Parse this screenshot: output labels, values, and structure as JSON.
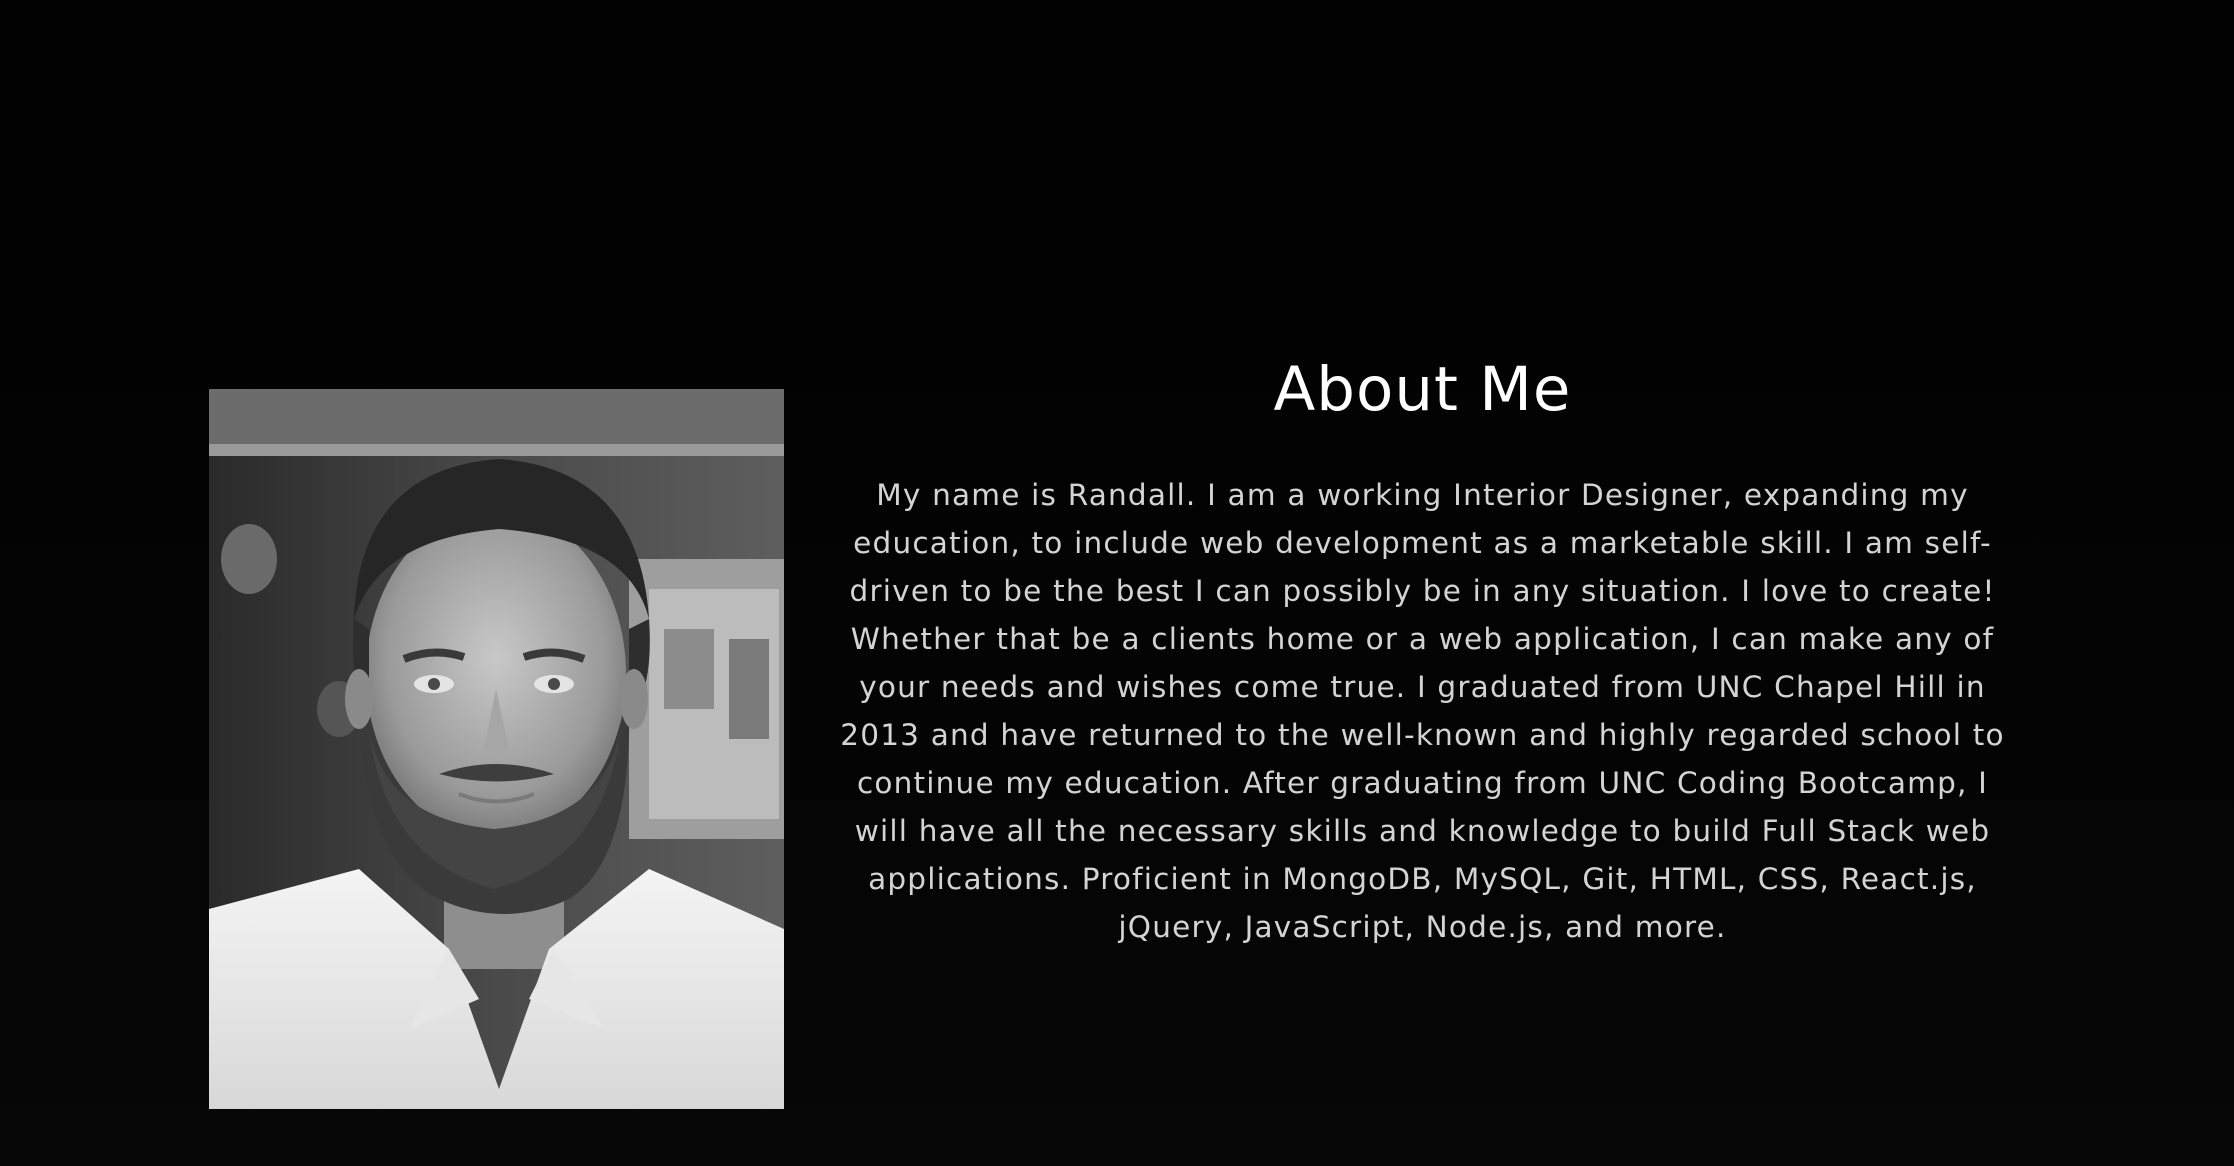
{
  "about": {
    "title": "About Me",
    "body": "My name is Randall. I am a working Interior Designer, expanding my education, to include web development as a marketable skill. I am self-driven to be the best I can possibly be in any situation. I love to create! Whether that be a clients home or a web application, I can make any of your needs and wishes come true. I graduated from UNC Chapel Hill in 2013 and have returned to the well-known and highly regarded school to continue my education. After graduating from UNC Coding Bootcamp, I will have all the necessary skills and knowledge to build Full Stack web applications. Proficient in MongoDB, MySQL, Git, HTML, CSS, React.js, jQuery, JavaScript, Node.js, and more."
  },
  "colors": {
    "background": "#050505",
    "title": "#ffffff",
    "body_text": "#d4d4d4"
  }
}
